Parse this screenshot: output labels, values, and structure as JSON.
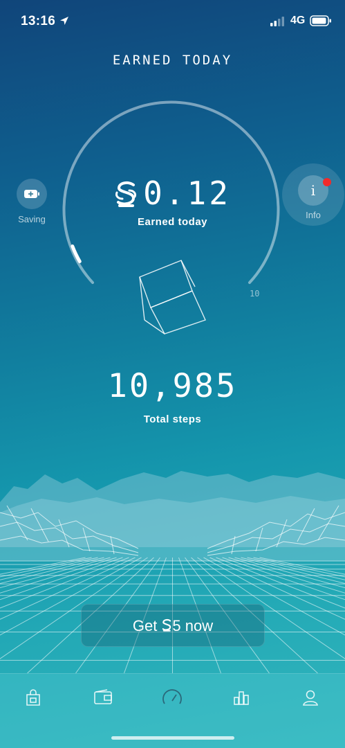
{
  "status_bar": {
    "time": "13:16",
    "network": "4G"
  },
  "header": {
    "title": "EARNED TODAY"
  },
  "balance": {
    "amount": "0.12",
    "label": "Earned today",
    "max_label": "10",
    "progress_fraction": 0.012
  },
  "saving": {
    "label": "Saving"
  },
  "info": {
    "label": "Info",
    "icon_text": "i",
    "has_notification": true
  },
  "steps": {
    "value": "10,985",
    "label": "Total steps"
  },
  "cta": {
    "prefix": "Get ",
    "amount": "5",
    "suffix": " now"
  },
  "tabbar": {
    "items": [
      {
        "icon": "shopping-bag-icon"
      },
      {
        "icon": "wallet-icon"
      },
      {
        "icon": "speedometer-icon",
        "active": true
      },
      {
        "icon": "bar-chart-icon"
      },
      {
        "icon": "profile-icon"
      }
    ]
  },
  "colors": {
    "accent_notification": "#f02b2b",
    "background_top": "#10457a",
    "background_bottom": "#32b6bd"
  }
}
